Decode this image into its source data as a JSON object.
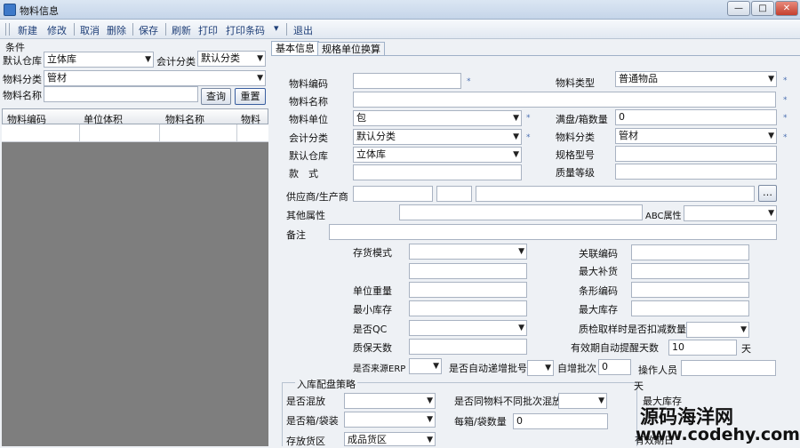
{
  "window": {
    "title": "物料信息",
    "min": "—",
    "max": "□",
    "close": "✕"
  },
  "toolbar": [
    "新建",
    "修改",
    "取消",
    "删除",
    "保存",
    "刷新",
    "打印",
    "打印条码",
    "退出"
  ],
  "toolbar_dropdown": "▾",
  "filter": {
    "group": "条件",
    "warehouse_label": "默认仓库",
    "warehouse_value": "立体库",
    "acct_label": "会计分类",
    "acct_value": "默认分类",
    "mat_cat_label": "物料分类",
    "mat_cat_value": "管材",
    "name_label": "物料名称",
    "name_value": "",
    "query_btn": "查询",
    "reset_btn": "重置"
  },
  "grid": {
    "columns": [
      "物料编码",
      "单位体积",
      "物料名称",
      "物料规"
    ]
  },
  "tabs": [
    "基本信息",
    "规格单位换算"
  ],
  "form": {
    "code_label": "物料编码",
    "type_label": "物料类型",
    "type_value": "普通物品",
    "name_label": "物料名称",
    "unit_label": "物料单位",
    "unit_value": "包",
    "box_qty_label": "满盘/箱数量",
    "box_qty_value": "0",
    "acct_label": "会计分类",
    "acct_value": "默认分类",
    "cat_label": "物料分类",
    "cat_value": "管材",
    "wh_label": "默认仓库",
    "wh_value": "立体库",
    "spec_label": "规格型号",
    "style_label": "款　式",
    "grade_label": "质量等级",
    "supplier_label": "供应商/生产商",
    "other_label": "其他属性",
    "abc_label": "ABC属性",
    "remark_label": "备注",
    "stock_mode_label": "存货模式",
    "link_code_label": "关联编码",
    "max_restock_label": "最大补货",
    "unit_weight_label": "单位重量",
    "barcode_label": "条形编码",
    "min_stock_label": "最小库存",
    "max_stock_label": "最大库存",
    "is_qc_label": "是否QC",
    "qc_deduct_label": "质检取样时是否扣减数量",
    "shelf_life_label": "质保天数",
    "expiry_warn_label": "有效期自动提醒天数",
    "expiry_warn_value": "10",
    "expiry_unit": "天",
    "is_erp_label": "是否来源ERP",
    "auto_batch_label": "是否自动递增批号",
    "batch_label": "自增批次",
    "batch_value": "0",
    "operator_label": "操作人员",
    "day_unit": "天",
    "inbound_section": "入库配盘策略",
    "mix_label": "是否混放",
    "mix_batch_label": "是否同物料不同批次混放",
    "box_label": "是否箱/袋装",
    "per_box_label": "每箱/袋数量",
    "per_box_value": "0",
    "max_stock2_label": "最大库存",
    "area_label": "存放货区",
    "area_value": "成品货区",
    "expiry2_label": "有效期日",
    "ellipsis": "…",
    "required": "*"
  },
  "watermark": {
    "line1": "源码海洋网",
    "line2": "www.codehy.com"
  }
}
